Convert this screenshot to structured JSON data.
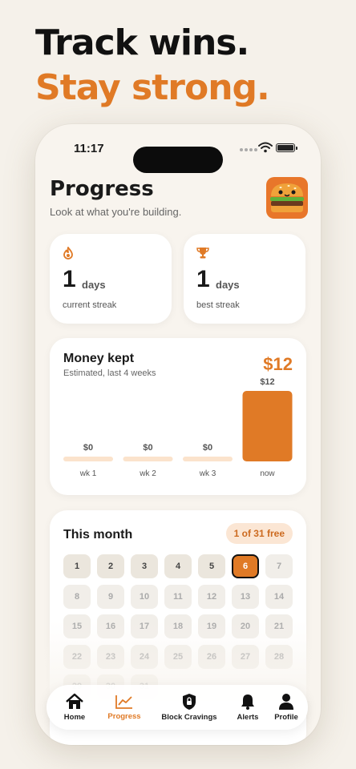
{
  "promo": {
    "line1": "Track wins.",
    "line2": "Stay strong."
  },
  "status": {
    "time": "11:17"
  },
  "header": {
    "title": "Progress",
    "subtitle": "Look at what you're building."
  },
  "streaks": [
    {
      "icon": "flame-icon",
      "value": "1",
      "unit": "days",
      "label": "current streak"
    },
    {
      "icon": "trophy-icon",
      "value": "1",
      "unit": "days",
      "label": "best streak"
    }
  ],
  "money": {
    "title": "Money kept",
    "subtitle": "Estimated, last 4 weeks",
    "total": "$12"
  },
  "chart_data": {
    "type": "bar",
    "categories": [
      "wk 1",
      "wk 2",
      "wk 3",
      "now"
    ],
    "values": [
      0,
      0,
      0,
      12
    ],
    "value_labels": [
      "$0",
      "$0",
      "$0",
      "$12"
    ],
    "title": "",
    "xlabel": "",
    "ylabel": "",
    "ylim": [
      0,
      12
    ]
  },
  "month": {
    "title": "This month",
    "badge": "1 of 31 free",
    "today": 6,
    "past_days": [
      1,
      2,
      3,
      4,
      5
    ],
    "days": [
      "1",
      "2",
      "3",
      "4",
      "5",
      "6",
      "7",
      "8",
      "9",
      "10",
      "11",
      "12",
      "13",
      "14",
      "15",
      "16",
      "17",
      "18",
      "19",
      "20",
      "21",
      "22",
      "23",
      "24",
      "25",
      "26",
      "27",
      "28",
      "29",
      "30",
      "31"
    ]
  },
  "colors": {
    "accent": "#e07a26",
    "bar_empty": "#fbe3cc",
    "background": "#f5f1ea"
  },
  "tabs": [
    {
      "label": "Home",
      "icon": "home-icon",
      "active": false
    },
    {
      "label": "Progress",
      "icon": "chart-icon",
      "active": true
    },
    {
      "label": "Block Cravings",
      "icon": "shield-lock-icon",
      "active": false
    },
    {
      "label": "Alerts",
      "icon": "bell-icon",
      "active": false
    },
    {
      "label": "Profile",
      "icon": "person-icon",
      "active": false
    }
  ]
}
